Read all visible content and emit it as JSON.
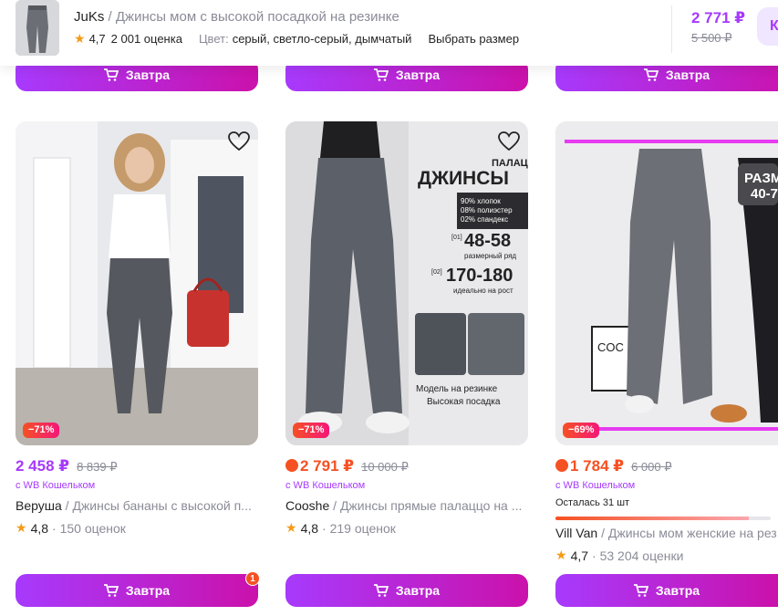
{
  "topbar": {
    "brand": "JuKs",
    "separator": "/",
    "product_name": "Джинсы мом с высокой посадкой на резинке",
    "rating": "4,7",
    "reviews": "2 001 оценка",
    "color_label": "Цвет:",
    "color_value": "серый, светло-серый, дымчатый",
    "size_link": "Выбрать размер",
    "price_now": "2 771 ₽",
    "price_old": "5 500 ₽",
    "cart_button_label": "К"
  },
  "prev_row_buttons": [
    "Завтра",
    "Завтра",
    "Завтра"
  ],
  "products": [
    {
      "discount": "−71%",
      "price_now": "2 458 ₽",
      "price_old": "8 839 ₽",
      "wallet": "с WB Кошельком",
      "brand": "Веруша",
      "name": "Джинсы бананы с высокой посадкой",
      "name_display": "Джинсы бананы с высокой п...",
      "rating": "4,8",
      "reviews": "150 оценок",
      "button": "Завтра",
      "badge": "1"
    },
    {
      "discount": "−71%",
      "price_now": "2 791 ₽",
      "price_old": "10 000 ₽",
      "wallet": "с WB Кошельком",
      "brand": "Cooshe",
      "name": "Джинсы прямые палаццо на резинке",
      "name_display": "Джинсы прямые палаццо на ...",
      "rating": "4,8",
      "reviews": "219 оценок",
      "button": "Завтра",
      "image_text": {
        "line1": "ПАЛАЦЦО",
        "line2": "ДЖИНСЫ",
        "comp1": "90% хлопок",
        "comp2": "08% полиэстер",
        "comp3": "02% спандекс",
        "tag1": "[01]",
        "size": "48-58",
        "size_caption": "размерный ряд",
        "tag2": "[02]",
        "height": "170-180",
        "height_caption": "идеально на рост",
        "feature1": "Модель на резинке",
        "feature2": "Высокая посадка"
      }
    },
    {
      "discount": "−69%",
      "price_now": "1 784 ₽",
      "price_old": "6 000 ₽",
      "wallet": "с WB Кошельком",
      "stock_left": "Осталась 31 шт",
      "stock_fraction": 0.9,
      "brand": "Vill Van",
      "name": "Джинсы мом женские на резинке",
      "name_display": "Джинсы мом женские на рез",
      "rating": "4,7",
      "reviews": "53 204 оценки",
      "button": "Завтра",
      "image_text": {
        "line1": "РАЗМЕ",
        "line2": "40-7",
        "sign": "COC"
      }
    }
  ],
  "colors": {
    "accent": "#a73afd",
    "accent2": "#cb11ab",
    "sale": "#f55123",
    "star": "#f59b16",
    "muted": "#8b8b98"
  },
  "icons": [
    "cart-icon",
    "heart-icon",
    "star-icon",
    "fire-icon"
  ]
}
